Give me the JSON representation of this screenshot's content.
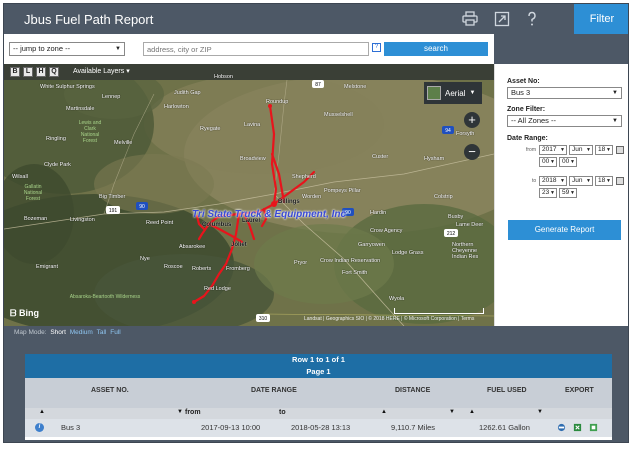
{
  "header": {
    "title": "Jbus Fuel Path Report",
    "filter_label": "Filter",
    "icons": [
      "printer-icon",
      "external-link-icon",
      "help-icon"
    ]
  },
  "search": {
    "zone_jump_value": "-- jump to zone --",
    "address_placeholder": "address, city or ZIP",
    "help_label": "?",
    "search_label": "search"
  },
  "map": {
    "toolbar_buttons": [
      "B",
      "L",
      "H",
      "Q"
    ],
    "available_layers_label": "Available Layers",
    "aerial_label": "Aerial",
    "zoom_in": "+",
    "zoom_out": "−",
    "bing_label": "Bing",
    "copyright": "Landsat | Geographics SIO | © 2018 HERE | © Microsoft Corporation | Terms",
    "overlay_label": "Tri State Truck & Equipment, Inc",
    "cities": [
      {
        "name": "Roundup"
      },
      {
        "name": "Melstone"
      },
      {
        "name": "Forsyth"
      },
      {
        "name": "Billings"
      },
      {
        "name": "Shepherd"
      },
      {
        "name": "Laurel"
      },
      {
        "name": "Columbus"
      },
      {
        "name": "Joliet"
      },
      {
        "name": "Red Lodge"
      },
      {
        "name": "Fromberg"
      },
      {
        "name": "Roberts"
      },
      {
        "name": "Absarokee"
      },
      {
        "name": "Big Timber"
      },
      {
        "name": "Livingston"
      },
      {
        "name": "Bozeman"
      },
      {
        "name": "Harlowton"
      },
      {
        "name": "Ryegate"
      },
      {
        "name": "Lavina"
      },
      {
        "name": "Broadview"
      },
      {
        "name": "Hardin"
      },
      {
        "name": "Crow Agency"
      },
      {
        "name": "Lodge Grass"
      },
      {
        "name": "Wyola"
      },
      {
        "name": "Lame Deer"
      },
      {
        "name": "Busby"
      },
      {
        "name": "Custer"
      },
      {
        "name": "Hysham"
      },
      {
        "name": "Pryor"
      },
      {
        "name": "Fort Smith"
      },
      {
        "name": "Crow Indian Reservation"
      },
      {
        "name": "Northern Cheyenne Indian Res"
      },
      {
        "name": "Gallatin National Forest"
      },
      {
        "name": "Lewis and Clark National Forest"
      },
      {
        "name": "Absaroka-Beartooth Wilderness"
      },
      {
        "name": "White Sulphur Springs"
      },
      {
        "name": "Martinsdale"
      },
      {
        "name": "Lennep"
      },
      {
        "name": "Ringling"
      },
      {
        "name": "Melville"
      },
      {
        "name": "Clyde Park"
      },
      {
        "name": "Hobson"
      },
      {
        "name": "Judith Gap"
      },
      {
        "name": "Roscoe"
      },
      {
        "name": "Nye"
      },
      {
        "name": "Emigrant"
      },
      {
        "name": "Wilsall"
      },
      {
        "name": "Reed Point"
      },
      {
        "name": "Musselshell"
      },
      {
        "name": "Colstrip"
      },
      {
        "name": "Garryowen"
      },
      {
        "name": "Pompeys Pillar"
      },
      {
        "name": "Worden"
      }
    ],
    "highway_shields": [
      "191",
      "90",
      "310",
      "94",
      "212",
      "87",
      "90"
    ]
  },
  "map_mode": {
    "label": "Map Mode:",
    "options": [
      "Short",
      "Medium",
      "Tall",
      "Full"
    ]
  },
  "filter_panel": {
    "asset_label": "Asset No:",
    "asset_value": "Bus 3",
    "zone_label": "Zone Filter:",
    "zone_value": "-- All Zones --",
    "date_range_label": "Date Range:",
    "from_label": "from",
    "to_label": "to",
    "from": {
      "year": "2017",
      "month": "Jun",
      "day": "18",
      "hour": "00",
      "minute": "00"
    },
    "to": {
      "year": "2018",
      "month": "Jun",
      "day": "18",
      "hour": "23",
      "minute": "59"
    },
    "generate_label": "Generate Report"
  },
  "results": {
    "row_info": "Row 1 to 1 of 1",
    "page_info": "Page  1",
    "columns": {
      "asset": "ASSET NO.",
      "date_range": "DATE RANGE",
      "distance": "DISTANCE",
      "fuel": "FUEL USED",
      "export": "EXPORT"
    },
    "sub_from": "from",
    "sub_to": "to",
    "rows": [
      {
        "asset": "Bus 3",
        "from": "2017-09-13 10:00",
        "to": "2018-05-28 13:13",
        "distance": "9,110.7 Miles",
        "fuel": "1262.61 Gallon"
      }
    ]
  },
  "colors": {
    "header_bg": "#4d5866",
    "accent": "#2d8fd5",
    "route": "#e8141c",
    "table_header": "#1e6ea5"
  }
}
